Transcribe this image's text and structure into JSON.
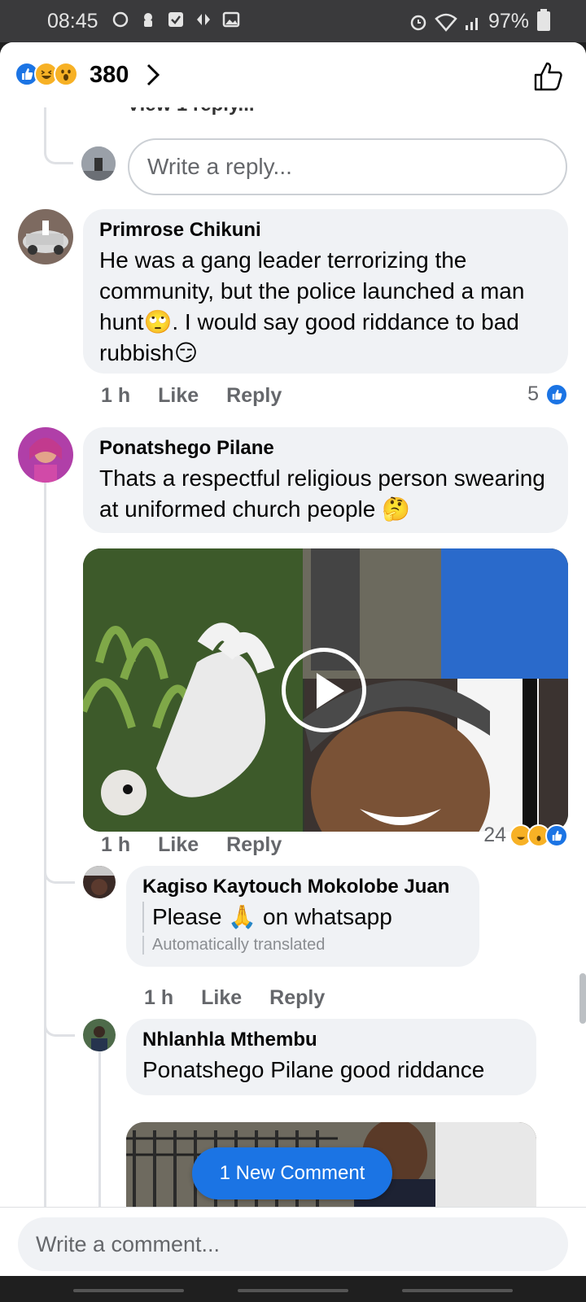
{
  "status_bar": {
    "time": "08:45",
    "battery": "97%"
  },
  "header": {
    "reaction_count": "380",
    "reactions": [
      "like",
      "haha",
      "wow"
    ]
  },
  "thread": {
    "cutoff_text": "View 1 reply...",
    "reply_placeholder": "Write a reply..."
  },
  "comments": [
    {
      "author": "Primrose Chikuni",
      "text": "He was a gang leader terrorizing the community, but the police launched a man hunt🙄. I would say good riddance to bad rubbish😏",
      "time": "1 h",
      "like_label": "Like",
      "reply_label": "Reply",
      "reaction_count": "5"
    },
    {
      "author": "Ponatshego Pilane",
      "text": "Thats a respectful religious person swearing at uniformed church people 🤔",
      "time": "1 h",
      "like_label": "Like",
      "reply_label": "Reply",
      "reaction_count": "24",
      "has_video": true
    }
  ],
  "replies": [
    {
      "author": "Kagiso Kaytouch Mokolobe Juan",
      "text": "Please 🙏 on whatsapp",
      "translated_note": "Automatically translated",
      "time": "1 h",
      "like_label": "Like",
      "reply_label": "Reply"
    },
    {
      "author": "Nhlanhla Mthembu",
      "text": "Ponatshego Pilane good riddance"
    }
  ],
  "new_comment_pill": "1 New Comment",
  "composer": {
    "placeholder": "Write a comment..."
  },
  "colors": {
    "accent": "#1b74e4",
    "bubble": "#f0f2f5",
    "meta": "#65676b"
  }
}
